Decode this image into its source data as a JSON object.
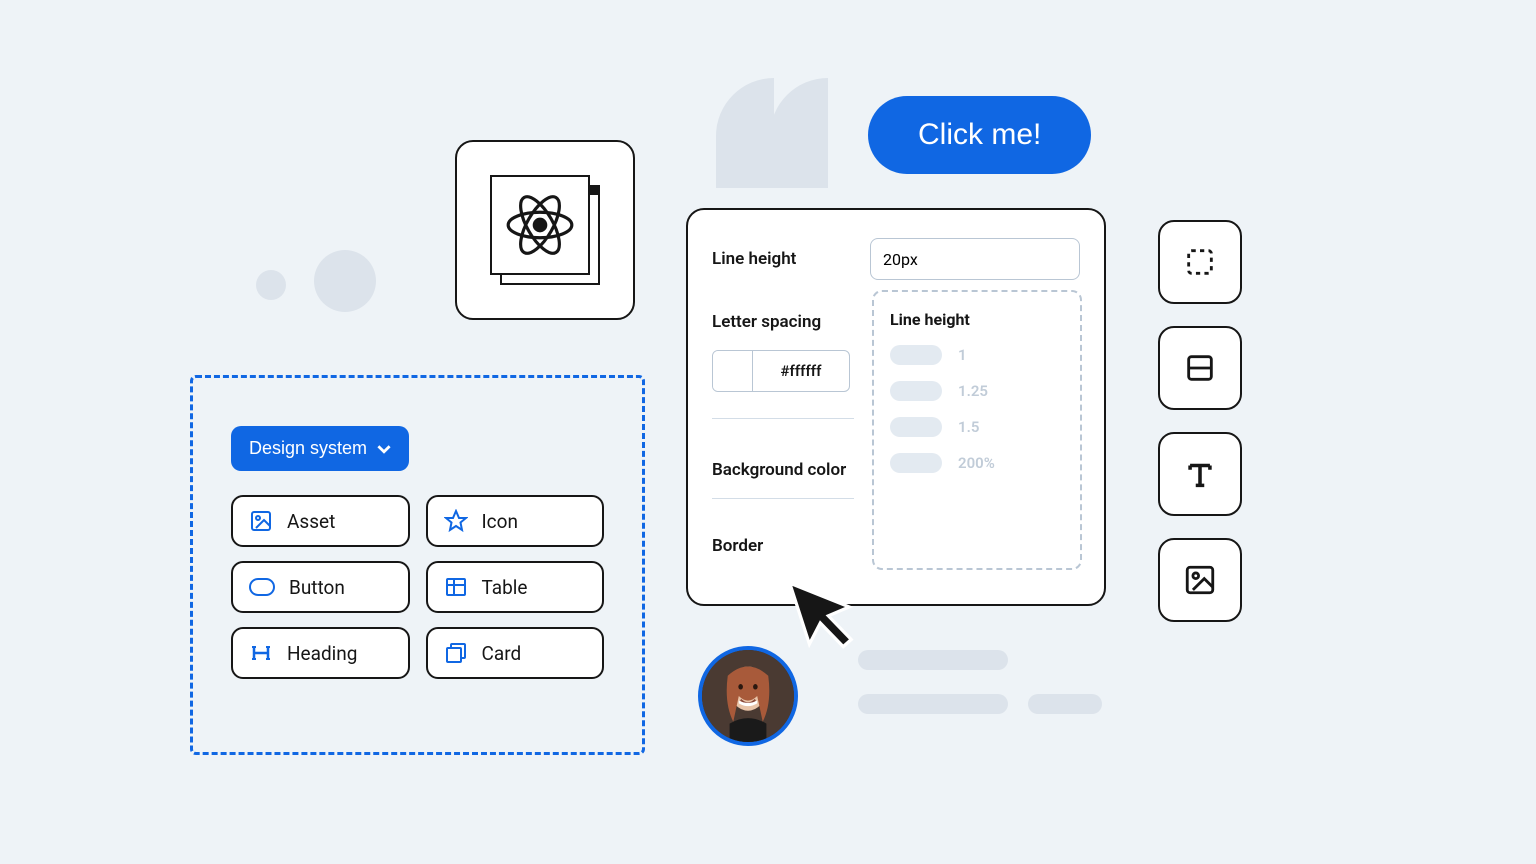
{
  "cta_label": "Click me!",
  "design_system": {
    "dropdown_label": "Design system",
    "items": [
      {
        "label": "Asset",
        "icon": "image-icon"
      },
      {
        "label": "Icon",
        "icon": "star-icon"
      },
      {
        "label": "Button",
        "icon": "pill-icon"
      },
      {
        "label": "Table",
        "icon": "table-icon"
      },
      {
        "label": "Heading",
        "icon": "heading-icon"
      },
      {
        "label": "Card",
        "icon": "card-stack-icon"
      }
    ]
  },
  "inspector": {
    "line_height_label": "Line height",
    "line_height_value": "20px",
    "letter_spacing_label": "Letter spacing",
    "color_hex": "#ffffff",
    "background_label": "Background color",
    "border_label": "Border",
    "dropdown": {
      "title": "Line height",
      "options": [
        "1",
        "1.25",
        "1.5",
        "200%"
      ]
    }
  },
  "toolbar_icons": [
    "select-icon",
    "layout-icon",
    "text-icon",
    "image-icon"
  ],
  "colors": {
    "accent": "#1067e3",
    "muted": "#dce3eb"
  }
}
